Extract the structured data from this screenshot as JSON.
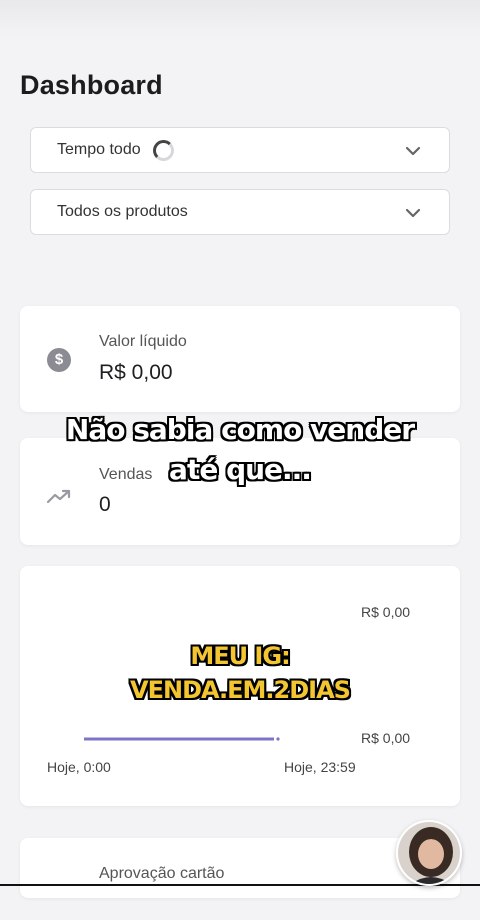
{
  "page": {
    "title": "Dashboard"
  },
  "filters": {
    "period": {
      "value": "Tempo todo",
      "icon": "chevron-down-icon"
    },
    "product": {
      "value": "Todos os produtos",
      "icon": "chevron-down-icon"
    }
  },
  "cards": {
    "net_value": {
      "label": "Valor líquido",
      "value": "R$ 0,00",
      "icon": "dollar-circle-icon"
    },
    "sales": {
      "label": "Vendas",
      "value": "0",
      "icon": "trending-up-icon"
    },
    "approval": {
      "label": "Aprovação cartão"
    }
  },
  "chart_data": {
    "type": "line",
    "x": [
      "Hoje, 0:00",
      "Hoje, 23:59"
    ],
    "y_labels": [
      "R$ 0,00",
      "R$ 0,00"
    ],
    "series": [
      {
        "values": [
          0,
          0
        ]
      }
    ],
    "colors": {
      "line": "#7b74c9"
    }
  },
  "overlay": {
    "line1": "Não sabia como vender",
    "line2": "até que...",
    "promo1": "MEU IG:",
    "promo2": "VENDA.EM.2DIAS"
  },
  "colors": {
    "background": "#f3f3f5",
    "card": "#ffffff",
    "accent": "#7b74c9"
  }
}
